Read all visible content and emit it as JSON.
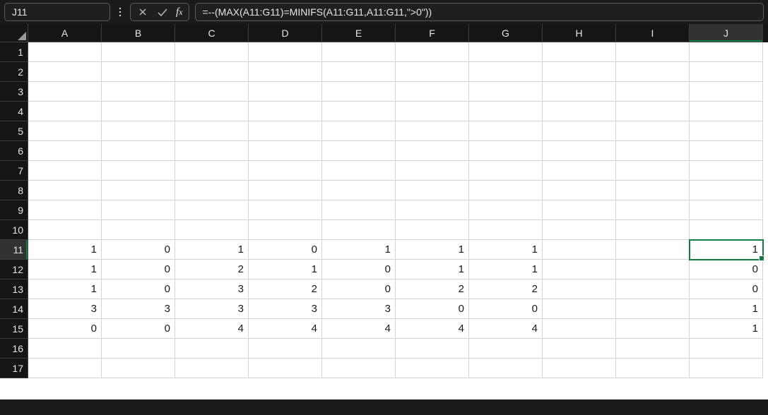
{
  "name_box": {
    "value": "J11"
  },
  "formula_bar": {
    "value": "=--(MAX(A11:G11)=MINIFS(A11:G11,A11:G11,\">0\"))"
  },
  "active_cell": {
    "col": 9,
    "row": 10
  },
  "columns": [
    "A",
    "B",
    "C",
    "D",
    "E",
    "F",
    "G",
    "H",
    "I",
    "J"
  ],
  "rows": [
    "1",
    "2",
    "3",
    "4",
    "5",
    "6",
    "7",
    "8",
    "9",
    "10",
    "11",
    "12",
    "13",
    "14",
    "15",
    "16",
    "17"
  ],
  "chart_data": {
    "type": "table",
    "title": "",
    "columns": [
      "A",
      "B",
      "C",
      "D",
      "E",
      "F",
      "G",
      "H",
      "I",
      "J"
    ],
    "rows_index": [
      11,
      12,
      13,
      14,
      15
    ],
    "data": [
      {
        "A": 1,
        "B": 0,
        "C": 1,
        "D": 0,
        "E": 1,
        "F": 1,
        "G": 1,
        "H": null,
        "I": null,
        "J": 1
      },
      {
        "A": 1,
        "B": 0,
        "C": 2,
        "D": 1,
        "E": 0,
        "F": 1,
        "G": 1,
        "H": null,
        "I": null,
        "J": 0
      },
      {
        "A": 1,
        "B": 0,
        "C": 3,
        "D": 2,
        "E": 0,
        "F": 2,
        "G": 2,
        "H": null,
        "I": null,
        "J": 0
      },
      {
        "A": 3,
        "B": 3,
        "C": 3,
        "D": 3,
        "E": 3,
        "F": 0,
        "G": 0,
        "H": null,
        "I": null,
        "J": 1
      },
      {
        "A": 0,
        "B": 0,
        "C": 4,
        "D": 4,
        "E": 4,
        "F": 4,
        "G": 4,
        "H": null,
        "I": null,
        "J": 1
      }
    ]
  },
  "cells": {
    "r10": {
      "c0": "1",
      "c1": "0",
      "c2": "1",
      "c3": "0",
      "c4": "1",
      "c5": "1",
      "c6": "1",
      "c7": "",
      "c8": "",
      "c9": "1"
    },
    "r11": {
      "c0": "1",
      "c1": "0",
      "c2": "2",
      "c3": "1",
      "c4": "0",
      "c5": "1",
      "c6": "1",
      "c7": "",
      "c8": "",
      "c9": "0"
    },
    "r12": {
      "c0": "1",
      "c1": "0",
      "c2": "3",
      "c3": "2",
      "c4": "0",
      "c5": "2",
      "c6": "2",
      "c7": "",
      "c8": "",
      "c9": "0"
    },
    "r13": {
      "c0": "3",
      "c1": "3",
      "c2": "3",
      "c3": "3",
      "c4": "3",
      "c5": "0",
      "c6": "0",
      "c7": "",
      "c8": "",
      "c9": "1"
    },
    "r14": {
      "c0": "0",
      "c1": "0",
      "c2": "4",
      "c3": "4",
      "c4": "4",
      "c5": "4",
      "c6": "4",
      "c7": "",
      "c8": "",
      "c9": "1"
    }
  }
}
